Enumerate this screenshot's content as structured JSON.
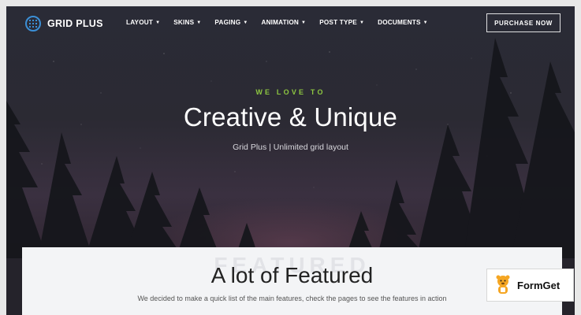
{
  "nav": {
    "logo_text": "GRID PLUS",
    "menu": [
      {
        "label": "LAYOUT"
      },
      {
        "label": "SKINS"
      },
      {
        "label": "PAGING"
      },
      {
        "label": "ANIMATION"
      },
      {
        "label": "POST TYPE"
      },
      {
        "label": "DOCUMENTS"
      }
    ],
    "purchase_label": "PURCHASE NOW"
  },
  "hero": {
    "eyebrow": "WE LOVE TO",
    "headline": "Creative & Unique",
    "subtitle": "Grid Plus | Unlimited grid layout"
  },
  "features": {
    "ghost_text": "FEATURED",
    "title": "A lot of Featured",
    "description": "We decided to make a quick list of the main features, check the pages to see the features in action"
  },
  "badge": {
    "label": "FormGet"
  },
  "colors": {
    "accent_green": "#8dc641",
    "logo_blue": "#3b8fd6"
  }
}
